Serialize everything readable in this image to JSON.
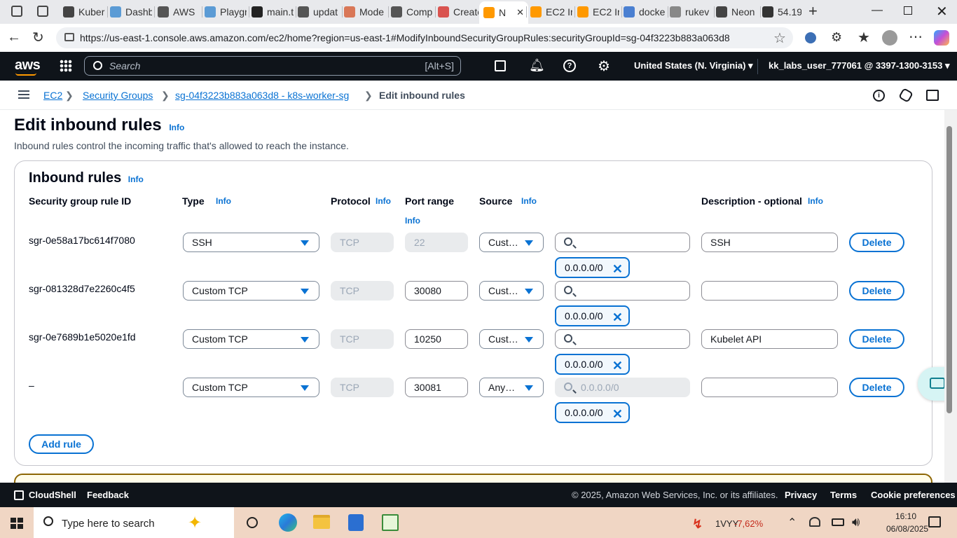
{
  "browser": {
    "tabs": [
      {
        "label": "Kuber",
        "color": "#444"
      },
      {
        "label": "Dashb",
        "color": "#5b9bd5"
      },
      {
        "label": "AWS",
        "color": "#555"
      },
      {
        "label": "Playgr",
        "color": "#5b9bd5"
      },
      {
        "label": "main.t",
        "color": "#222"
      },
      {
        "label": "updat",
        "color": "#555"
      },
      {
        "label": "Mode",
        "color": "#d97757"
      },
      {
        "label": "Comp",
        "color": "#555"
      },
      {
        "label": "Create",
        "color": "#d9534f"
      },
      {
        "label": "N",
        "color": "#ff9900"
      },
      {
        "label": "EC2 Ir",
        "color": "#ff9900"
      },
      {
        "label": "EC2 Ir",
        "color": "#ff9900"
      },
      {
        "label": "docke",
        "color": "#4a7fd1"
      },
      {
        "label": "rukev",
        "color": "#888"
      },
      {
        "label": "Neon",
        "color": "#444"
      },
      {
        "label": "54.19",
        "color": "#333"
      }
    ],
    "url": "https://us-east-1.console.aws.amazon.com/ec2/home?region=us-east-1#ModifyInboundSecurityGroupRules:securityGroupId=sg-04f3223b883a063d8"
  },
  "awsnav": {
    "logo": "aws",
    "search_placeholder": "Search",
    "search_shortcut": "[Alt+S]",
    "region": "United States (N. Virginia)",
    "account": "kk_labs_user_777061 @ 3397-1300-3153"
  },
  "breadcrumb": {
    "ec2": "EC2",
    "security_groups": "Security Groups",
    "sg": "sg-04f3223b883a063d8 - k8s-worker-sg",
    "current": "Edit inbound rules"
  },
  "page": {
    "title": "Edit inbound rules",
    "info": "Info",
    "description": "Inbound rules control the incoming traffic that's allowed to reach the instance."
  },
  "panel": {
    "title": "Inbound rules",
    "headers": {
      "rule_id": "Security group rule ID",
      "type": "Type",
      "protocol": "Protocol",
      "port_range": "Port range",
      "source": "Source",
      "description": "Description - optional"
    },
    "rows": [
      {
        "rule_id": "sgr-0e58a17bc614f7080",
        "type": "SSH",
        "protocol": "TCP",
        "port": "22",
        "source": "Cust…",
        "search": "",
        "cidr": "0.0.0.0/0",
        "description": "SSH",
        "delete": "Delete"
      },
      {
        "rule_id": "sgr-081328d7e2260c4f5",
        "type": "Custom TCP",
        "protocol": "TCP",
        "port": "30080",
        "source": "Cust…",
        "search": "",
        "cidr": "0.0.0.0/0",
        "description": "",
        "delete": "Delete"
      },
      {
        "rule_id": "sgr-0e7689b1e5020e1fd",
        "type": "Custom TCP",
        "protocol": "TCP",
        "port": "10250",
        "source": "Cust…",
        "search": "",
        "cidr": "0.0.0.0/0",
        "description": "Kubelet API",
        "delete": "Delete"
      },
      {
        "rule_id": "–",
        "type": "Custom TCP",
        "protocol": "TCP",
        "port": "30081",
        "source": "Any…",
        "search": "0.0.0.0/0",
        "cidr": "0.0.0.0/0",
        "description": "",
        "delete": "Delete"
      }
    ],
    "add_rule": "Add rule"
  },
  "footer": {
    "cloudshell": "CloudShell",
    "feedback": "Feedback",
    "copyright": "© 2025, Amazon Web Services, Inc. or its affiliates.",
    "privacy": "Privacy",
    "terms": "Terms",
    "cookies": "Cookie preferences"
  },
  "taskbar": {
    "search_placeholder": "Type here to search",
    "stock_name": "1VYY",
    "stock_change": "-7,62%",
    "time": "16:10",
    "date": "06/08/2025"
  }
}
